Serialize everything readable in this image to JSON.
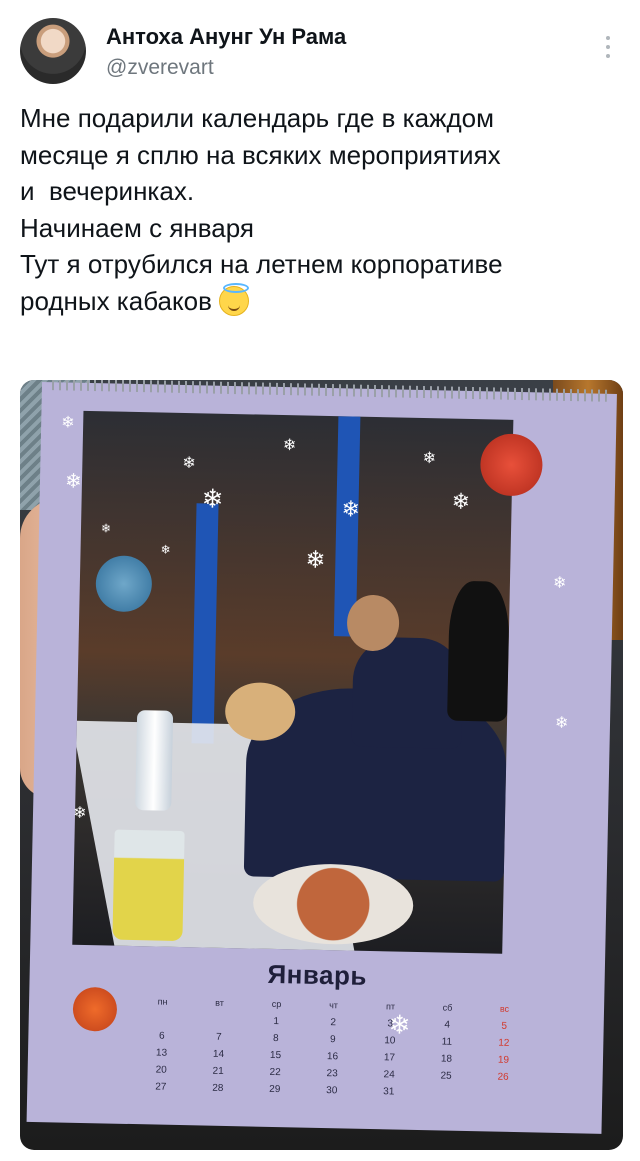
{
  "tweet": {
    "display_name": "Антоха Анунг Ун Рама",
    "username": "@zverevart",
    "text": "Мне подарили календарь где в каждом\nмесяце я сплю на всяких мероприятиях\nи  вечеринках.\nНачинаем с января\nТут я отрубился на летнем корпоративе\nродных кабаков ",
    "emoji": "smiling-face-with-halo"
  },
  "photo": {
    "calendar": {
      "month": "Январь",
      "weekdays": [
        "пн",
        "вт",
        "ср",
        "чт",
        "пт",
        "сб",
        "вс"
      ],
      "weeks": [
        [
          "",
          "",
          "1",
          "2",
          "3",
          "4",
          "5"
        ],
        [
          "6",
          "7",
          "8",
          "9",
          "10",
          "11",
          "12"
        ],
        [
          "13",
          "14",
          "15",
          "16",
          "17",
          "18",
          "19"
        ],
        [
          "20",
          "21",
          "22",
          "23",
          "24",
          "25",
          "26"
        ],
        [
          "27",
          "28",
          "29",
          "30",
          "31",
          "",
          ""
        ]
      ]
    }
  }
}
